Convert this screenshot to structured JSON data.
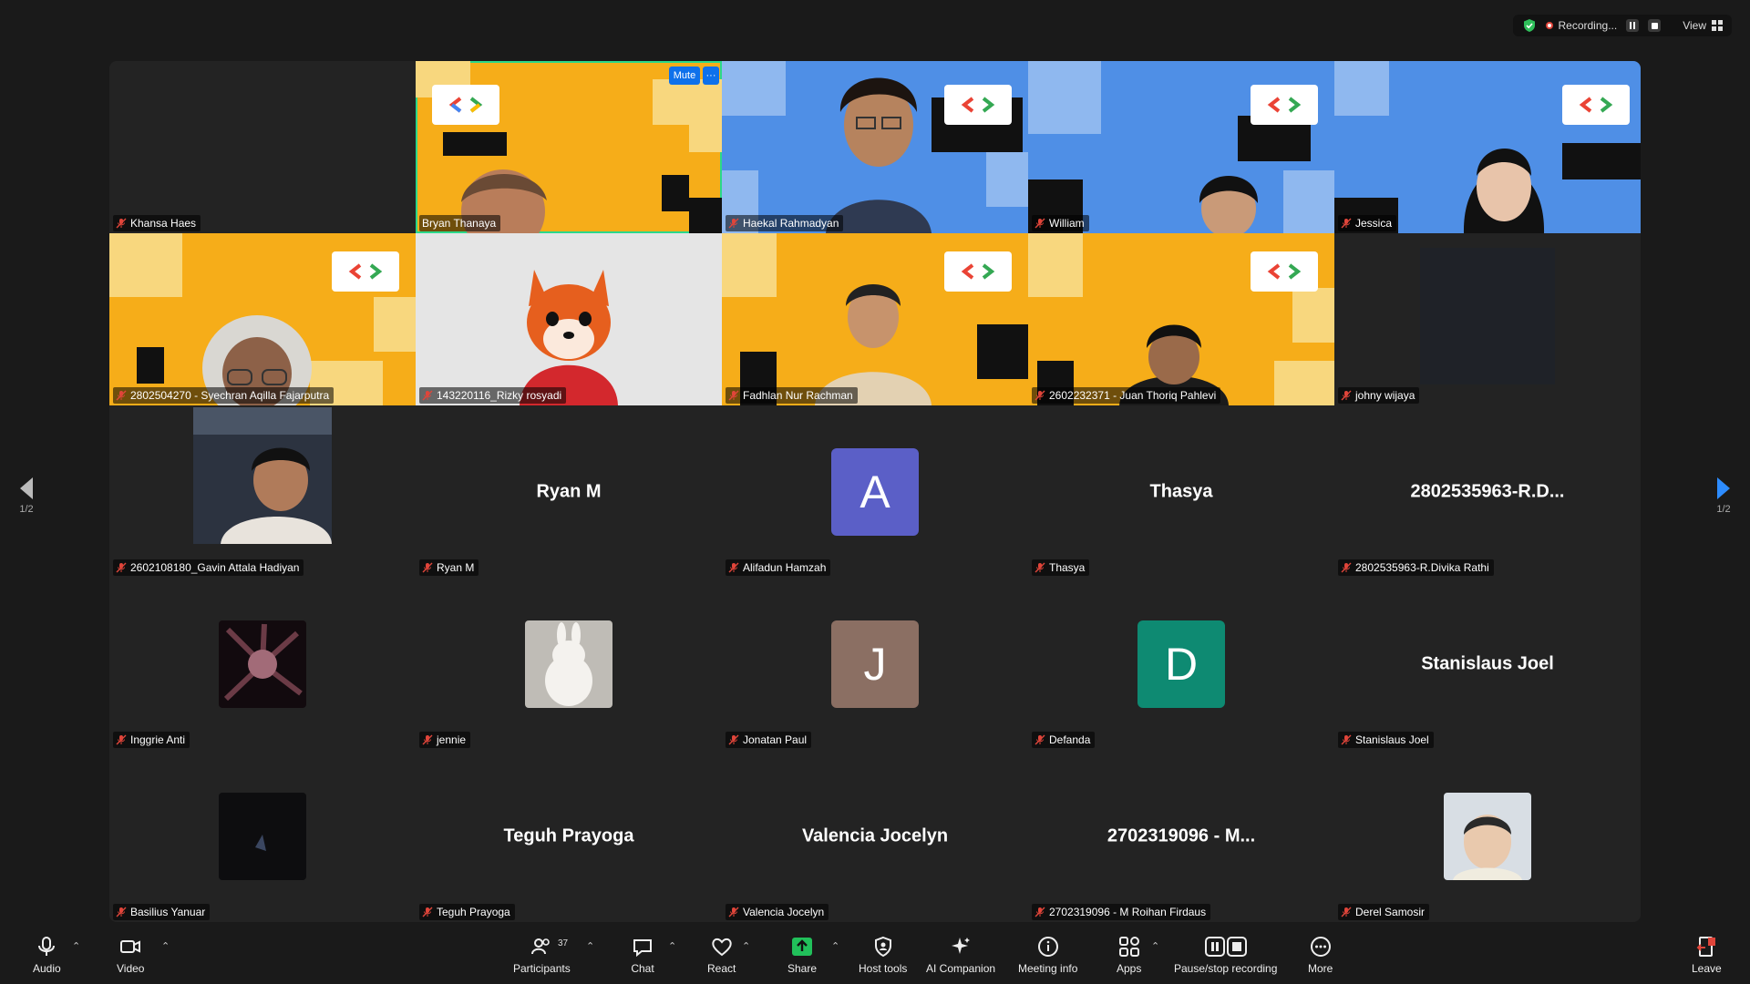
{
  "status_bar": {
    "recording_label": "Recording...",
    "view_label": "View"
  },
  "grid": {
    "page_left": "1/2",
    "page_right": "1/2",
    "row1": [
      {
        "name": "Khansa Haes"
      },
      {
        "name": "Bryan Thanaya",
        "mute_label": "Mute",
        "more_label": "···"
      },
      {
        "name": "Haekal Rahmadyan"
      },
      {
        "name": "William"
      },
      {
        "name": "Jessica"
      }
    ],
    "row2": [
      {
        "name": "2802504270 - Syechran Aqilla Fajarputra"
      },
      {
        "name": "143220116_Rizky rosyadi"
      },
      {
        "name": "Fadhlan Nur Rachman"
      },
      {
        "name": "2602232371 - Juan Thoriq Pahlevi"
      },
      {
        "name": "johny wijaya"
      }
    ],
    "row3": [
      {
        "name": "2602108180_Gavin Attala Hadiyan"
      },
      {
        "name": "Ryan M",
        "display": "Ryan M"
      },
      {
        "name": "Alifadun Hamzah",
        "initial": "A",
        "color": "#5b5fc7"
      },
      {
        "name": "Thasya",
        "display": "Thasya"
      },
      {
        "name": "2802535963-R.Divika Rathi",
        "display": "2802535963-R.D..."
      }
    ],
    "row4": [
      {
        "name": "Inggrie Anti"
      },
      {
        "name": "jennie"
      },
      {
        "name": "Jonatan Paul",
        "initial": "J",
        "color": "#8b6f63"
      },
      {
        "name": "Defanda",
        "initial": "D",
        "color": "#0e8a72"
      },
      {
        "name": "Stanislaus Joel",
        "display": "Stanislaus Joel"
      }
    ],
    "row5": [
      {
        "name": "Basilius Yanuar"
      },
      {
        "name": "Teguh Prayoga",
        "display": "Teguh Prayoga"
      },
      {
        "name": "Valencia Jocelyn",
        "display": "Valencia Jocelyn"
      },
      {
        "name": "2702319096 - M Roihan Firdaus",
        "display": "2702319096 - M..."
      },
      {
        "name": "Derel Samosir"
      }
    ]
  },
  "toolbar": {
    "audio": "Audio",
    "video": "Video",
    "participants": "Participants",
    "participants_count": "37",
    "chat": "Chat",
    "react": "React",
    "share": "Share",
    "host_tools": "Host tools",
    "ai_companion": "AI Companion",
    "meeting_info": "Meeting info",
    "apps": "Apps",
    "pause_stop": "Pause/stop recording",
    "more": "More",
    "leave": "Leave"
  },
  "colors": {
    "accent_blue": "#0e71eb",
    "active_speaker": "#2bd88a",
    "share_green": "#21c05a",
    "leave_red": "#e0453a"
  }
}
